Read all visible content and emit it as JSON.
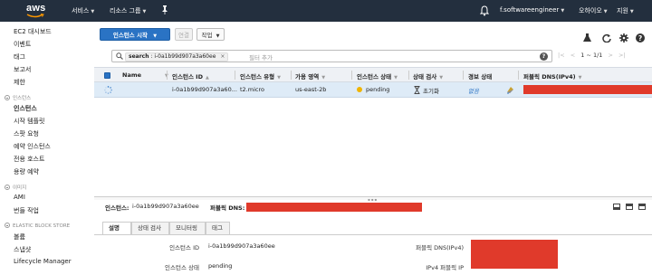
{
  "topnav": {
    "logo": "aws",
    "services": "서비스",
    "resource_groups": "리소스 그룹",
    "pin_icon": "pin-icon",
    "bell_icon": "bell-icon",
    "account": "f.softwareengineer",
    "region": "오하이오",
    "support": "지원",
    "background": "#232f3e"
  },
  "sidebar": {
    "items": [
      {
        "label": "EC2 대시보드"
      },
      {
        "label": "이벤트"
      },
      {
        "label": "태그"
      },
      {
        "label": "보고서"
      },
      {
        "label": "제한"
      }
    ],
    "sections": [
      {
        "title": "인스턴스",
        "items": [
          "인스턴스",
          "시작 템플릿",
          "스팟 요청",
          "예약 인스턴스",
          "전용 호스트",
          "용량 예약"
        ]
      },
      {
        "title": "이미지",
        "items": [
          "AMI",
          "번들 작업"
        ]
      },
      {
        "title": "ELASTIC BLOCK STORE",
        "items": [
          "볼륨",
          "스냅샷",
          "Lifecycle Manager"
        ]
      }
    ],
    "active_item": "인스턴스"
  },
  "toolbar": {
    "launch_button": "인스턴스 시작",
    "connect_button": "연결",
    "actions_button": "작업",
    "icons": [
      "flask-icon",
      "refresh-icon",
      "gear-icon",
      "help-icon"
    ]
  },
  "filter": {
    "chip_key": "search",
    "chip_value": "i-0a1b99d907a3a60ee",
    "placeholder": "필터 추가"
  },
  "pager": {
    "range": "1 ~ 1/1"
  },
  "table": {
    "columns": [
      "Name",
      "인스턴스 ID",
      "인스턴스 유형",
      "가용 영역",
      "인스턴스 상태",
      "상태 검사",
      "경보 상태",
      "퍼블릭 DNS(IPv4)"
    ],
    "rows": [
      {
        "name": "",
        "instance_id": "i-0a1b99d907a3a60...",
        "type": "t2.micro",
        "az": "us-east-2b",
        "state": "pending",
        "status_check": "초기화",
        "alarm": "없음",
        "public_dns": ""
      }
    ],
    "accent": "#2a73c4",
    "redaction_color": "#e03a2b"
  },
  "detail": {
    "header_instance_label": "인스턴스:",
    "header_instance_value": "i-0a1b99d907a3a60ee",
    "header_dns_label": "퍼블릭 DNS:",
    "tabs": [
      "설명",
      "상태 검사",
      "모니터링",
      "태그"
    ],
    "active_tab": "설명",
    "rows": [
      {
        "key": "인스턴스 ID",
        "value": "i-0a1b99d907a3a60ee",
        "key2": "퍼블릭 DNS(IPv4)"
      },
      {
        "key": "인스턴스 상태",
        "value": "pending",
        "key2": "IPv4 퍼블릭 IP"
      }
    ]
  }
}
